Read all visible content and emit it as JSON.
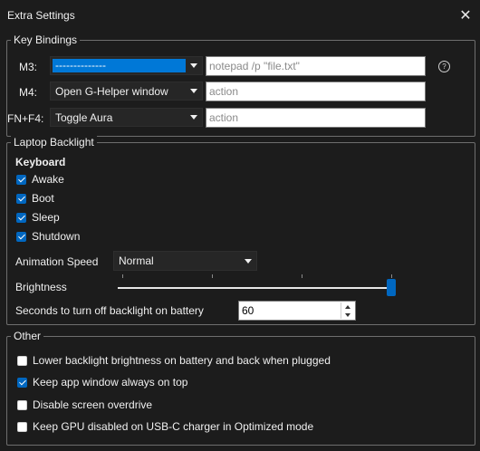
{
  "window": {
    "title": "Extra Settings",
    "close_glyph": "✕"
  },
  "key_bindings": {
    "legend": "Key Bindings",
    "rows": [
      {
        "label": "M3:",
        "action": "--------------",
        "placeholder": "notepad /p \"file.txt\""
      },
      {
        "label": "M4:",
        "action": "Open G-Helper window",
        "placeholder": "action"
      },
      {
        "label": "FN+F4:",
        "action": "Toggle Aura",
        "placeholder": "action"
      }
    ],
    "help_glyph": "?"
  },
  "backlight": {
    "legend": "Laptop Backlight",
    "keyboard_heading": "Keyboard",
    "options": [
      {
        "label": "Awake",
        "checked": true
      },
      {
        "label": "Boot",
        "checked": true
      },
      {
        "label": "Sleep",
        "checked": true
      },
      {
        "label": "Shutdown",
        "checked": true
      }
    ],
    "animation_speed_label": "Animation Speed",
    "animation_speed_value": "Normal",
    "brightness_label": "Brightness",
    "brightness_level": 1.0,
    "timeout_label": "Seconds to turn off backlight on battery",
    "timeout_value": "60"
  },
  "other": {
    "legend": "Other",
    "options": [
      {
        "label": "Lower backlight brightness on battery and back when plugged",
        "checked": false
      },
      {
        "label": "Keep app window always on top",
        "checked": true
      },
      {
        "label": "Disable screen overdrive",
        "checked": false
      },
      {
        "label": "Keep GPU disabled on USB-C charger in Optimized mode",
        "checked": false
      }
    ]
  },
  "colors": {
    "background": "#1c1c1c",
    "accent": "#0067c0",
    "selection": "#0078d7"
  }
}
